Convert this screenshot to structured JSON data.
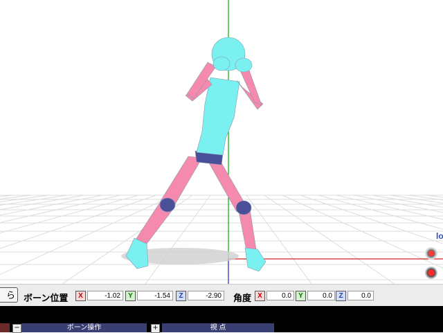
{
  "viewport": {
    "axis_label": "lo"
  },
  "bone_bar": {
    "edit_button_label": "ら編",
    "position_label": "ボーン位置",
    "angle_label": "角度",
    "axes": {
      "x": "X",
      "y": "Y",
      "z": "Z"
    },
    "position": {
      "x": "-1.02",
      "y": "-1.54",
      "z": "-2.90"
    },
    "angle": {
      "x": "0.0",
      "y": "0.0",
      "z": "0.0"
    }
  },
  "panels": {
    "bone_ops": {
      "title": "ボーン操作",
      "collapse": "−"
    },
    "view": {
      "title": "視 点",
      "expand": "+"
    }
  },
  "colors": {
    "body_pink": "#f58aae",
    "body_cyan": "#7af0f0",
    "joint_navy": "#4a4f9a",
    "grid": "#dcdcdc",
    "axis_green": "#00b400",
    "axis_red": "#d22222",
    "axis_blue": "#2222d2"
  },
  "icons": {
    "gizmo_top": "rotate-gizmo-icon",
    "gizmo_bottom": "move-gizmo-icon"
  }
}
